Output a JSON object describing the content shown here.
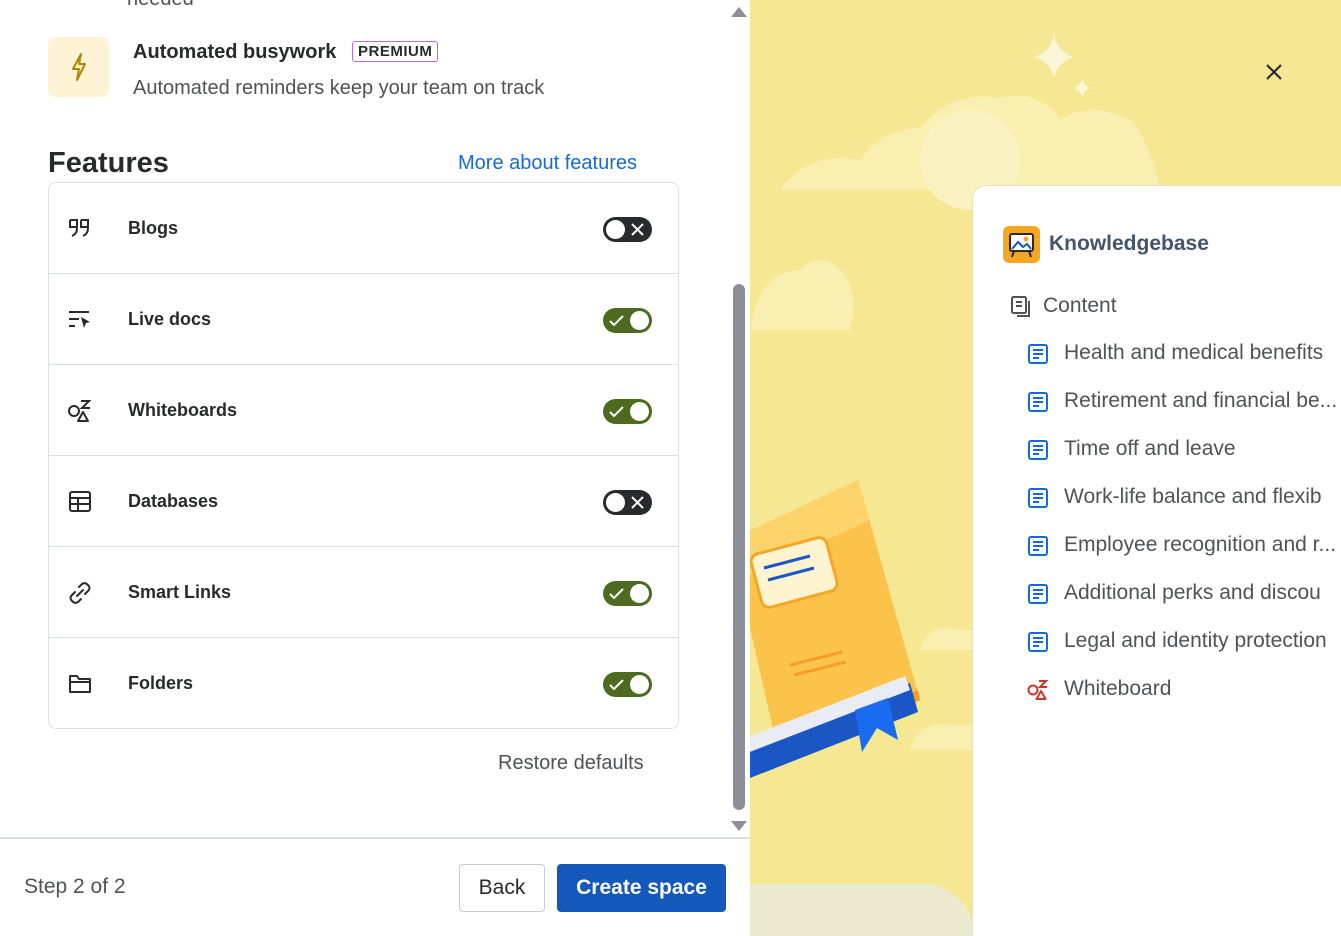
{
  "top_cut_text": "needed",
  "busywork": {
    "title": "Automated busywork",
    "badge": "PREMIUM",
    "description": "Automated reminders keep your team on track",
    "icon": "lightning-icon"
  },
  "features": {
    "heading": "Features",
    "more_link": "More about features",
    "items": [
      {
        "label": "Blogs",
        "icon": "quote-icon",
        "enabled": false
      },
      {
        "label": "Live docs",
        "icon": "live-doc-icon",
        "enabled": true
      },
      {
        "label": "Whiteboards",
        "icon": "whiteboard-icon",
        "enabled": true
      },
      {
        "label": "Databases",
        "icon": "database-icon",
        "enabled": false
      },
      {
        "label": "Smart Links",
        "icon": "link-icon",
        "enabled": true
      },
      {
        "label": "Folders",
        "icon": "folder-icon",
        "enabled": true
      }
    ],
    "restore": "Restore defaults"
  },
  "footer": {
    "step": "Step 2 of 2",
    "back": "Back",
    "create": "Create space"
  },
  "preview": {
    "space_name": "Knowledgebase",
    "content_label": "Content",
    "pages": [
      {
        "label": "Health and medical benefits",
        "type": "page"
      },
      {
        "label": "Retirement and financial be...",
        "type": "page"
      },
      {
        "label": "Time off and leave",
        "type": "page"
      },
      {
        "label": "Work-life balance and flexib",
        "type": "page"
      },
      {
        "label": "Employee recognition and r...",
        "type": "page"
      },
      {
        "label": "Additional perks and discou",
        "type": "page"
      },
      {
        "label": "Legal and identity protection",
        "type": "page"
      },
      {
        "label": "Whiteboard",
        "type": "whiteboard"
      }
    ]
  },
  "colors": {
    "primary": "#1558bc",
    "link": "#1868db",
    "toggle_on": "#4c6b1f",
    "toggle_off": "#292a2e",
    "preview_bg": "#f6e893"
  }
}
